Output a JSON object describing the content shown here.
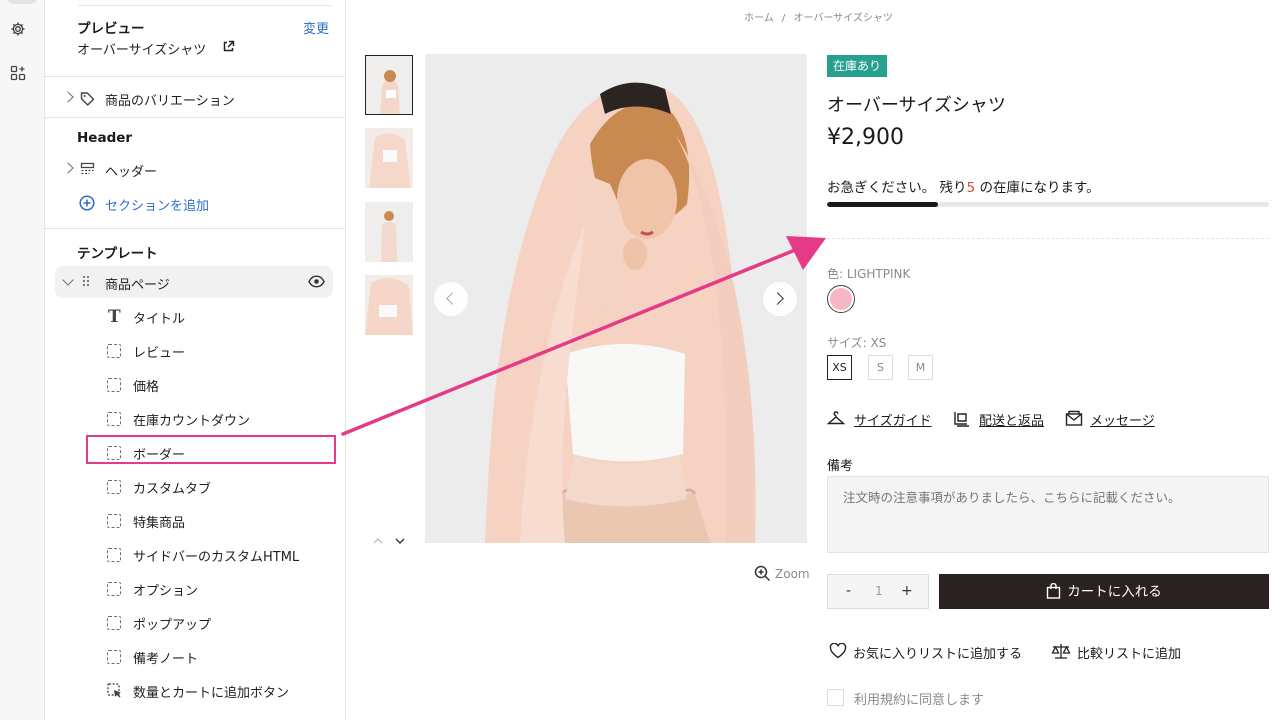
{
  "sidebar": {
    "preview_title": "プレビュー",
    "preview_change": "変更",
    "preview_page": "オーバーサイズシャツ",
    "variations": "商品のバリエーション",
    "header_title": "Header",
    "header_item": "ヘッダー",
    "add_section": "セクションを追加",
    "template_title": "テンプレート",
    "template_item": "商品ページ",
    "blocks": [
      "タイトル",
      "レビュー",
      "価格",
      "在庫カウントダウン",
      "ボーダー",
      "カスタムタブ",
      "特集商品",
      "サイドバーのカスタムHTML",
      "オプション",
      "ポップアップ",
      "備考ノート",
      "数量とカートに追加ボタン"
    ],
    "highlighted_block": "ボーダー"
  },
  "product": {
    "breadcrumb_home": "ホーム",
    "breadcrumb_sep": "/",
    "breadcrumb_current": "オーバーサイズシャツ",
    "badge": "在庫あり",
    "title": "オーバーサイズシャツ",
    "price": "¥2,900",
    "stock_prefix": "お急ぎください。 残り",
    "stock_count": "5",
    "stock_suffix": " の在庫になります。",
    "stock_level": 0.25,
    "color_label": "色: LIGHTPINK",
    "swatch_color": "#f7b6c3",
    "size_label": "サイズ: XS",
    "sizes": [
      "XS",
      "S",
      "M"
    ],
    "selected_size": "XS",
    "size_guide": "サイズガイド",
    "shipping": "配送と返品",
    "message": "メッセージ",
    "note_label": "備考",
    "note_placeholder": "注文時の注意事項がありましたら、こちらに記載ください。",
    "zoom": "Zoom",
    "qty_minus": "-",
    "qty_value": "1",
    "qty_plus": "+",
    "add_to_cart": "カートに入れる",
    "wishlist": "お気に入りリストに追加する",
    "compare": "比較リストに追加",
    "terms": "利用規約に同意します"
  },
  "colors": {
    "accent_link": "#2c6ecb",
    "badge": "#25a18e",
    "annotation": "#e53a88",
    "cart_button": "#2a2220"
  }
}
